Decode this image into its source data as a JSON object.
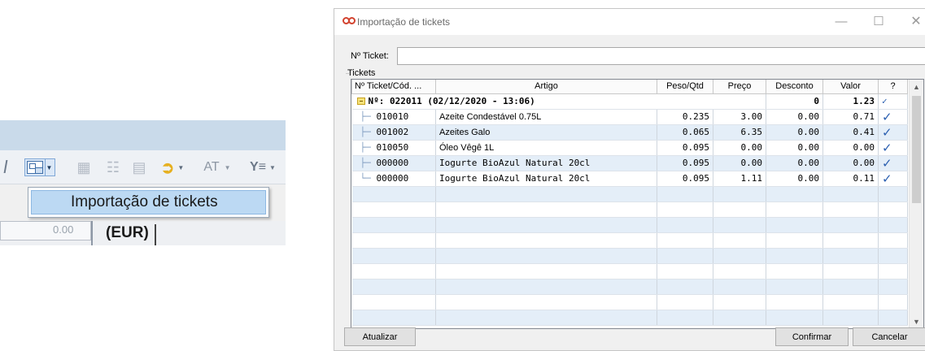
{
  "toolbar_crop": {
    "menu_item": "Importação de tickets",
    "left_cell_value": "0.00",
    "currency_label": "(EUR)",
    "at_label": "AT",
    "icons": [
      "import-tickets-icon",
      "dropdown-arrow-icon",
      "grid-icon",
      "list-icon",
      "report-icon",
      "wizard-icon",
      "filter-icon"
    ]
  },
  "dialog": {
    "title": "Importação de tickets",
    "window_controls": {
      "minimize": "—",
      "maximize": "☐",
      "close": "✕"
    },
    "ticket_label": "Nº Ticket:",
    "ticket_value": "",
    "group_label": "Tickets",
    "columns": [
      "Nº Ticket/Cód. ...",
      "Artigo",
      "Peso/Qtd",
      "Preço",
      "Desconto",
      "Valor",
      "?"
    ],
    "group_row": {
      "label": "Nº: 022011 (02/12/2020 - 13:06)",
      "desconto": "0",
      "valor": "1.23",
      "check": "✓"
    },
    "rows": [
      {
        "code": "010010",
        "artigo": "Azeite Condestável 0.75L",
        "peso": "0.235",
        "preco": "3.00",
        "desconto": "0.00",
        "valor": "0.71",
        "check": "✓"
      },
      {
        "code": "001002",
        "artigo": "Azeites Galo",
        "peso": "0.065",
        "preco": "6.35",
        "desconto": "0.00",
        "valor": "0.41",
        "check": "✓"
      },
      {
        "code": "010050",
        "artigo": "Óleo Vêgê 1L",
        "peso": "0.095",
        "preco": "0.00",
        "desconto": "0.00",
        "valor": "0.00",
        "check": "✓"
      },
      {
        "code": "000000",
        "artigo": "Iogurte BioAzul Natural 20cl",
        "peso": "0.095",
        "preco": "0.00",
        "desconto": "0.00",
        "valor": "0.00",
        "check": "✓"
      },
      {
        "code": "000000",
        "artigo": "Iogurte BioAzul Natural 20cl",
        "peso": "0.095",
        "preco": "1.11",
        "desconto": "0.00",
        "valor": "0.11",
        "check": "✓"
      }
    ],
    "buttons": {
      "refresh": "Atualizar",
      "confirm": "Confirmar",
      "cancel": "Cancelar"
    },
    "accent": "#2b5fb0",
    "row_alt_color": "#e4eef8"
  }
}
